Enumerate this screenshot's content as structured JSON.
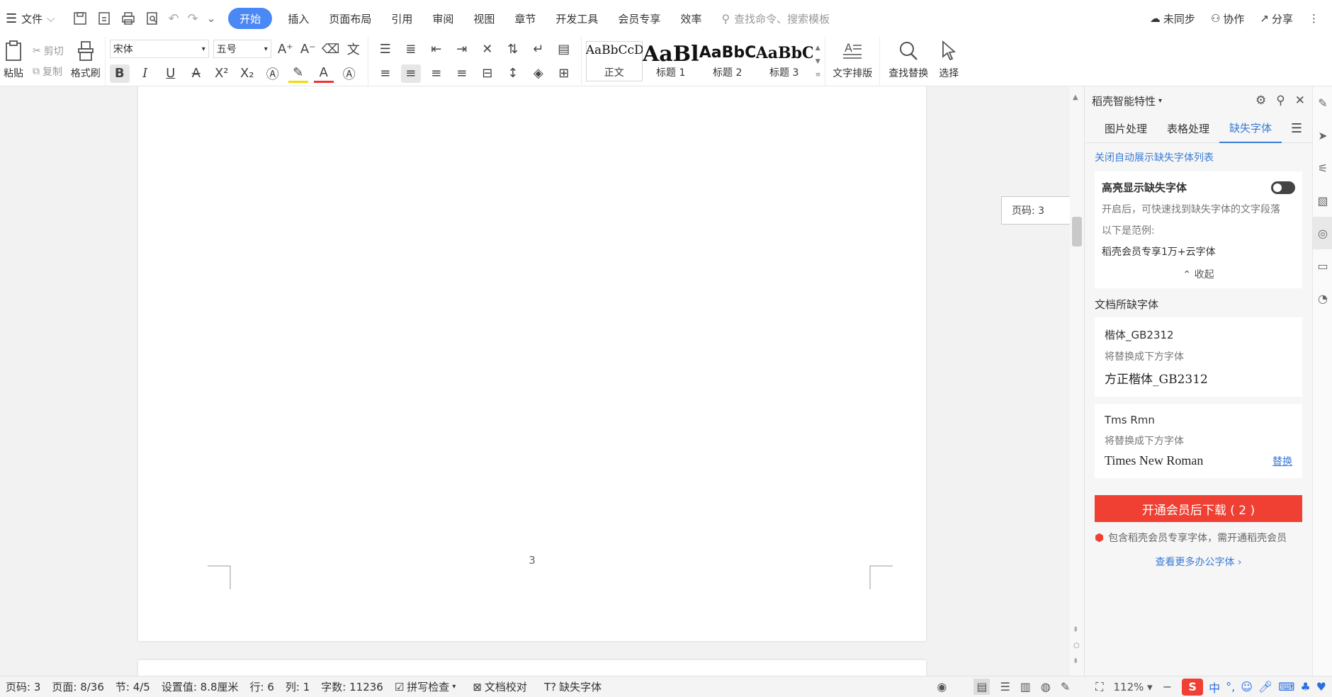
{
  "menubar": {
    "file_label": "文件",
    "tabs": [
      "开始",
      "插入",
      "页面布局",
      "引用",
      "审阅",
      "视图",
      "章节",
      "开发工具",
      "会员专享",
      "效率"
    ],
    "active_tab": "开始",
    "search_placeholder": "查找命令、搜索模板",
    "right": {
      "sync": "未同步",
      "collab": "协作",
      "share": "分享"
    }
  },
  "ribbon": {
    "paste": "粘贴",
    "cut": "剪切",
    "copy": "复制",
    "format_painter": "格式刷",
    "font_name": "宋体",
    "font_size": "五号",
    "styles": [
      {
        "preview": "AaBbCcDd",
        "label": "正文"
      },
      {
        "preview": "AaBl",
        "label": "标题 1"
      },
      {
        "preview": "AaBbC",
        "label": "标题 2"
      },
      {
        "preview": "AaBbC",
        "label": "标题 3"
      }
    ],
    "text_layout": "文字排版",
    "find_replace": "查找替换",
    "select": "选择"
  },
  "document": {
    "page_number": "3",
    "tooltip": "页码: 3"
  },
  "panel": {
    "title": "稻壳智能特性",
    "tabs": [
      "图片处理",
      "表格处理",
      "缺失字体"
    ],
    "active_tab": "缺失字体",
    "close_auto_link": "关闭自动展示缺失字体列表",
    "highlight_card": {
      "title": "高亮显示缺失字体",
      "desc": "开启后，可快速找到缺失字体的文字段落",
      "example_label": "以下是范例:",
      "example": "稻壳会员专享1万+云字体",
      "collapse": "收起"
    },
    "missing_title": "文档所缺字体",
    "fonts": [
      {
        "name": "楷体_GB2312",
        "replace_hint": "将替换成下方字体",
        "replacement": "方正楷体_GB2312",
        "action": ""
      },
      {
        "name": "Tms Rmn",
        "replace_hint": "将替换成下方字体",
        "replacement": "Times New Roman",
        "action": "替换"
      }
    ],
    "cta": "开通会员后下载 ( 2 )",
    "note": "包含稻壳会员专享字体，需开通稻壳会员",
    "more_link": "查看更多办公字体"
  },
  "statusbar": {
    "page_code": "页码: 3",
    "page": "页面: 8/36",
    "section": "节: 4/5",
    "setting": "设置值: 8.8厘米",
    "row": "行: 6",
    "col": "列: 1",
    "words": "字数: 11236",
    "spell": "拼写检查",
    "proof": "文档校对",
    "missing_font": "缺失字体",
    "zoom": "112%"
  },
  "ime": {
    "logo": "S",
    "lang": "中"
  }
}
